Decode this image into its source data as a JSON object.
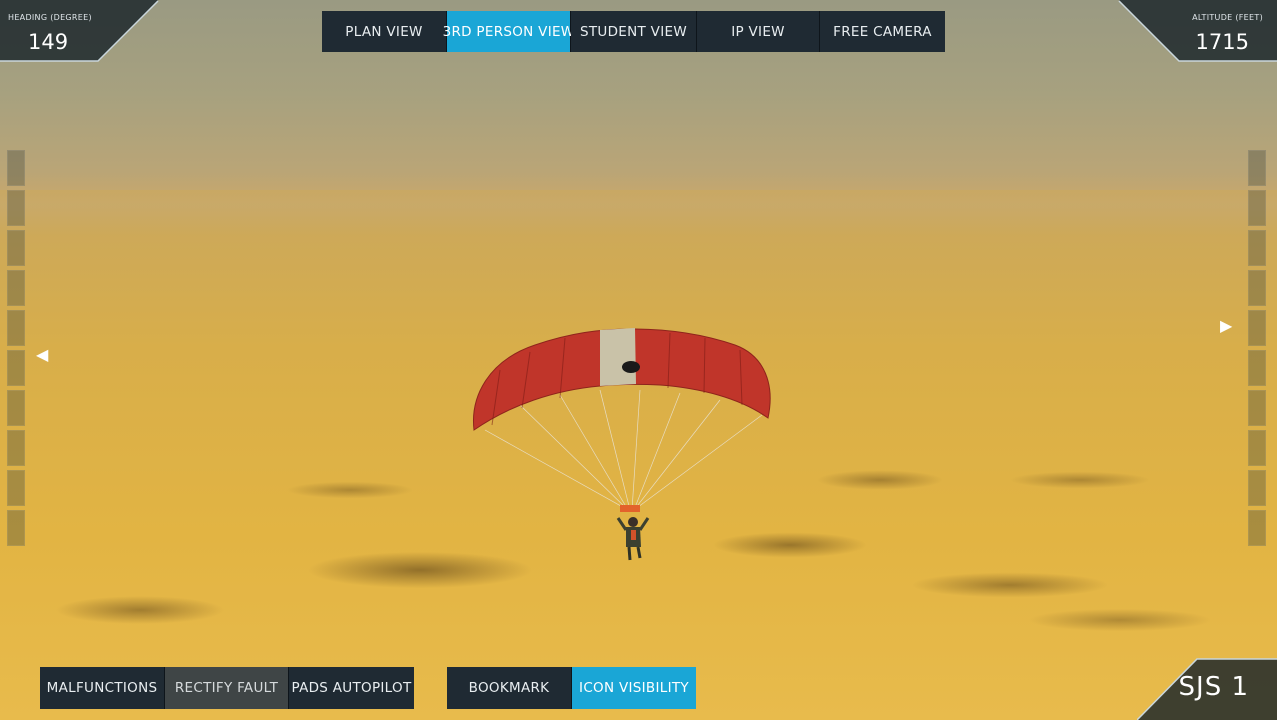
{
  "heading": {
    "label": "HEADING (DEGREE)",
    "value": "149"
  },
  "altitude": {
    "label": "ALTITUDE (FEET)",
    "value": "1715"
  },
  "views": [
    {
      "label": "PLAN VIEW",
      "active": false
    },
    {
      "label": "3RD PERSON VIEW",
      "active": true
    },
    {
      "label": "STUDENT VIEW",
      "active": false
    },
    {
      "label": "IP VIEW",
      "active": false
    },
    {
      "label": "FREE CAMERA",
      "active": false
    }
  ],
  "bottom_left": [
    {
      "label": "MALFUNCTIONS"
    },
    {
      "label": "RECTIFY FAULT"
    },
    {
      "label": "PADS AUTOPILOT"
    }
  ],
  "bottom_mid": [
    {
      "label": "BOOKMARK"
    },
    {
      "label": "ICON VISIBILITY"
    }
  ],
  "sim_id": "SJS 1",
  "icons": {
    "left_arrow": "left-arrow-icon",
    "right_arrow": "right-arrow-icon"
  },
  "colors": {
    "button_bg": "#1f2a33",
    "active_bg": "#1aa6d6",
    "canopy": "#c0352a"
  }
}
